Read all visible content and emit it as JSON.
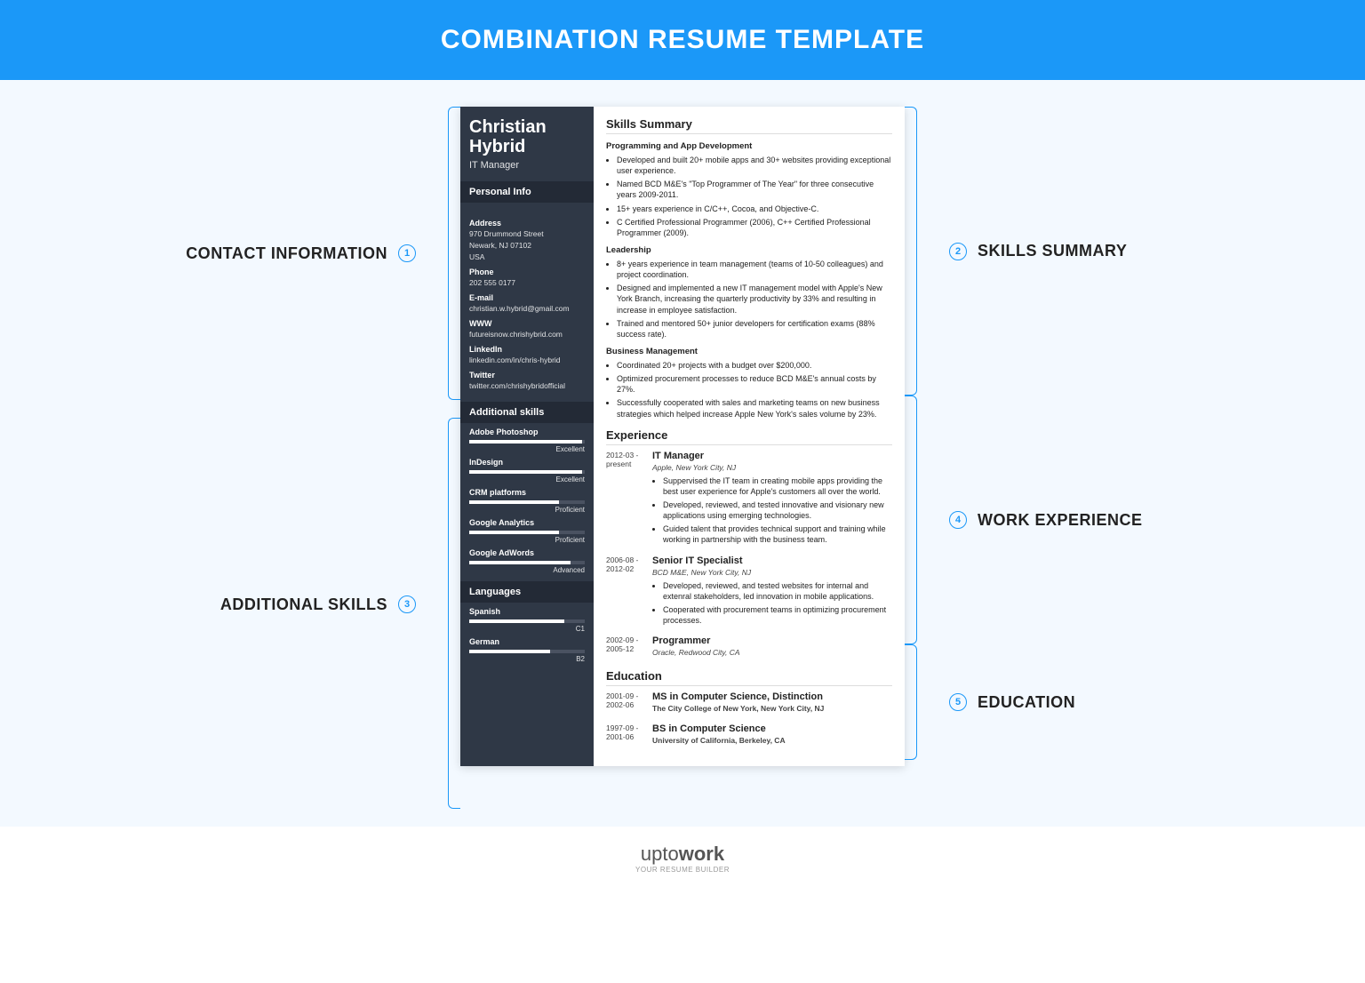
{
  "banner": "COMBINATION RESUME TEMPLATE",
  "callouts": {
    "left": [
      {
        "num": "1",
        "label": "CONTACT INFORMATION"
      },
      {
        "num": "3",
        "label": "ADDITIONAL SKILLS"
      }
    ],
    "right": [
      {
        "num": "2",
        "label": "SKILLS SUMMARY"
      },
      {
        "num": "4",
        "label": "WORK EXPERIENCE"
      },
      {
        "num": "5",
        "label": "EDUCATION"
      }
    ]
  },
  "resume": {
    "name_first": "Christian",
    "name_last": "Hybrid",
    "title": "IT Manager",
    "personal_info_h": "Personal Info",
    "info": [
      {
        "label": "Address",
        "lines": [
          "970 Drummond Street",
          "Newark, NJ 07102",
          "USA"
        ]
      },
      {
        "label": "Phone",
        "lines": [
          "202 555 0177"
        ]
      },
      {
        "label": "E-mail",
        "lines": [
          "christian.w.hybrid@gmail.com"
        ]
      },
      {
        "label": "WWW",
        "lines": [
          "futureisnow.chrishybrid.com"
        ]
      },
      {
        "label": "LinkedIn",
        "lines": [
          "linkedin.com/in/chris-hybrid"
        ]
      },
      {
        "label": "Twitter",
        "lines": [
          "twitter.com/chrishybridofficial"
        ]
      }
    ],
    "addskills_h": "Additional skills",
    "skills": [
      {
        "name": "Adobe Photoshop",
        "level": "Excellent",
        "pct": 98
      },
      {
        "name": "InDesign",
        "level": "Excellent",
        "pct": 98
      },
      {
        "name": "CRM platforms",
        "level": "Proficient",
        "pct": 78
      },
      {
        "name": "Google Analytics",
        "level": "Proficient",
        "pct": 78
      },
      {
        "name": "Google AdWords",
        "level": "Advanced",
        "pct": 88
      }
    ],
    "languages_h": "Languages",
    "languages": [
      {
        "name": "Spanish",
        "level": "C1",
        "pct": 82
      },
      {
        "name": "German",
        "level": "B2",
        "pct": 70
      }
    ],
    "skills_summary_h": "Skills Summary",
    "summary_groups": [
      {
        "heading": "Programming and App Development",
        "items": [
          "Developed and built 20+ mobile apps and 30+ websites providing exceptional user experience.",
          "Named BCD M&E's \"Top Programmer of The Year\" for three consecutive years 2009-2011.",
          "15+ years experience in C/C++, Cocoa, and Objective-C.",
          "C Certified Professional Programmer (2006), C++ Certified Professional Programmer (2009)."
        ]
      },
      {
        "heading": "Leadership",
        "items": [
          "8+ years experience in team management (teams of 10-50 colleagues) and project coordination.",
          "Designed and implemented a new IT management model with Apple's New York Branch, increasing the quarterly productivity by 33% and resulting in increase in employee satisfaction.",
          "Trained and mentored 50+ junior developers for certification exams (88% success rate)."
        ]
      },
      {
        "heading": "Business Management",
        "items": [
          "Coordinated 20+ projects with a budget over $200,000.",
          "Optimized procurement processes to reduce BCD M&E's annual costs by 27%.",
          "Successfully cooperated with sales and marketing teams on new business strategies which helped increase Apple New York's sales volume by 23%."
        ]
      }
    ],
    "experience_h": "Experience",
    "experience": [
      {
        "dates": "2012-03 - present",
        "title": "IT Manager",
        "company": "Apple, New York City, NJ",
        "bullets": [
          "Suppervised the IT team in creating mobile apps providing the best user experience for Apple's customers all over the world.",
          "Developed, reviewed, and tested innovative and visionary new applications using emerging technologies.",
          "Guided talent that provides technical support and training while working in partnership with the business team."
        ]
      },
      {
        "dates": "2006-08 - 2012-02",
        "title": "Senior IT Specialist",
        "company": "BCD M&E, New York City, NJ",
        "bullets": [
          "Developed, reviewed, and tested websites for internal and extenral stakeholders, led innovation in mobile applications.",
          "Cooperated with procurement teams in optimizing procurement processes."
        ]
      },
      {
        "dates": "2002-09 - 2005-12",
        "title": "Programmer",
        "company": "Oracle, Redwood City, CA",
        "bullets": []
      }
    ],
    "education_h": "Education",
    "education": [
      {
        "dates": "2001-09 - 2002-06",
        "title": "MS in Computer Science, Distinction",
        "school": "The City College of New York, New York City, NJ"
      },
      {
        "dates": "1997-09 - 2001-06",
        "title": "BS in Computer Science",
        "school": "University of California, Berkeley, CA"
      }
    ]
  },
  "footer": {
    "brand_a": "upto",
    "brand_b": "work",
    "tag": "YOUR RESUME BUILDER"
  }
}
